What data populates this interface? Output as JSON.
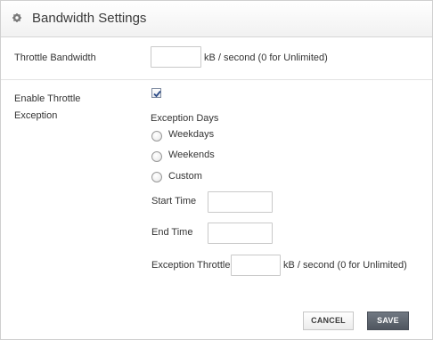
{
  "header": {
    "title": "Bandwidth Settings",
    "icon": "gear-icon"
  },
  "throttle": {
    "label": "Throttle Bandwidth",
    "value": "",
    "unit": "kB / second (0 for Unlimited)"
  },
  "exception": {
    "label_line1": "Enable Throttle",
    "label_line2": "Exception",
    "enabled": true,
    "days_label": "Exception Days",
    "days_options": [
      {
        "label": "Weekdays",
        "selected": false
      },
      {
        "label": "Weekends",
        "selected": false
      },
      {
        "label": "Custom",
        "selected": false
      }
    ],
    "start_time_label": "Start Time",
    "start_time_value": "",
    "end_time_label": "End Time",
    "end_time_value": "",
    "throttle_label": "Exception Throttle",
    "throttle_value": "",
    "throttle_unit": "kB / second (0 for Unlimited)"
  },
  "buttons": {
    "cancel": "CANCEL",
    "save": "SAVE"
  },
  "colors": {
    "save_button": "#5a616a",
    "checkbox_check": "#2b4a86"
  }
}
